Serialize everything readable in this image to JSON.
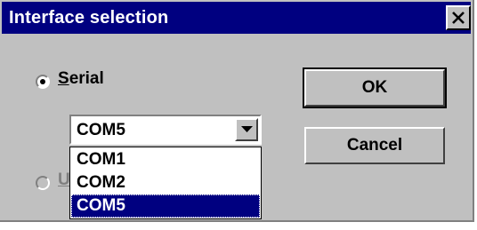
{
  "dialog": {
    "title": "Interface selection",
    "close_label": "×"
  },
  "options": {
    "serial": {
      "prefix": "",
      "underlined": "S",
      "rest": "erial",
      "selected": true
    },
    "other": {
      "prefix": "",
      "underlined": "U",
      "rest": "",
      "selected": false,
      "disabled": true
    }
  },
  "combo": {
    "value": "COM5",
    "items": [
      "COM1",
      "COM2",
      "COM5"
    ],
    "selected_index": 2
  },
  "buttons": {
    "ok_label": "OK",
    "cancel_label": "Cancel"
  },
  "colors": {
    "title_bar": "#000080",
    "face": "#c0c0c0",
    "highlight": "#000080"
  }
}
